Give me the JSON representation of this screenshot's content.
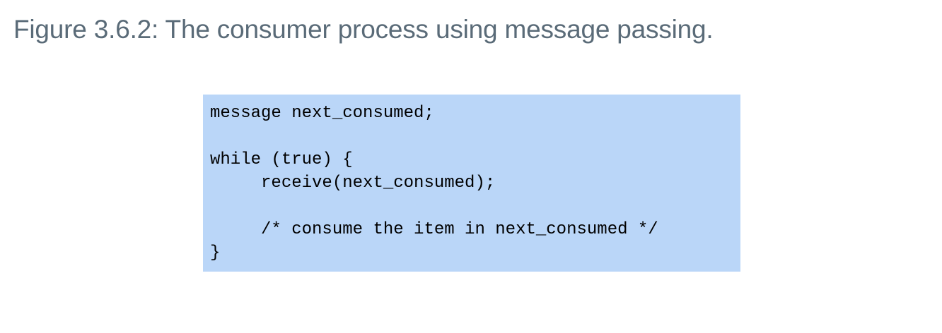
{
  "figure": {
    "caption": "Figure 3.6.2: The consumer process using message passing."
  },
  "code": {
    "lines": [
      "message next_consumed;",
      "",
      "while (true) {",
      "     receive(next_consumed);",
      "",
      "     /* consume the item in next_consumed */",
      "}"
    ]
  },
  "colors": {
    "caption_text": "#5a6b78",
    "code_background": "#bad6f8",
    "code_text": "#000000"
  }
}
